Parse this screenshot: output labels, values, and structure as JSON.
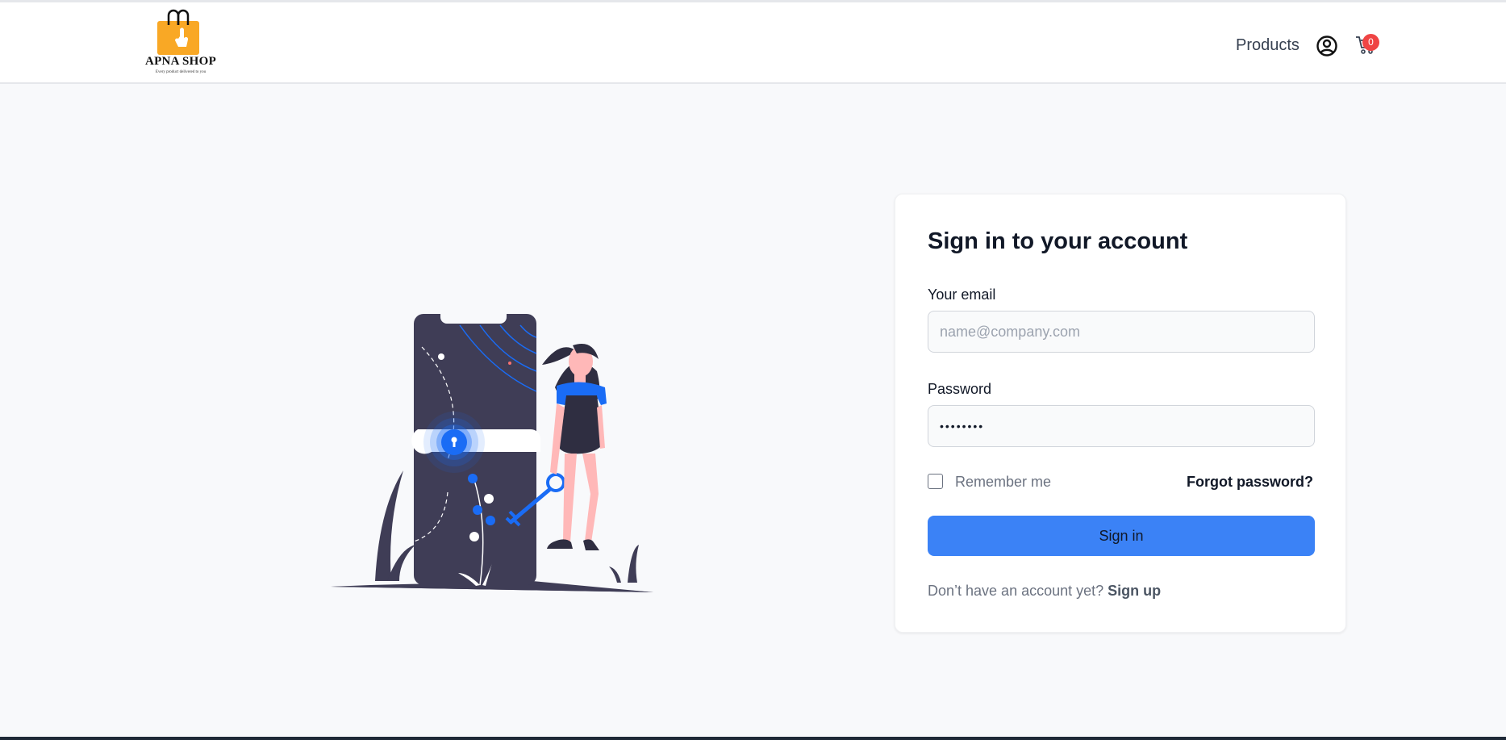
{
  "header": {
    "logo_name": "APNA SHOP",
    "logo_tagline": "Every product delivered to you",
    "nav_products": "Products",
    "cart_count": "0"
  },
  "login": {
    "title": "Sign in to your account",
    "email_label": "Your email",
    "email_placeholder": "name@company.com",
    "email_value": "",
    "password_label": "Password",
    "password_value": "••••••••",
    "remember_label": "Remember me",
    "remember_checked": false,
    "forgot_label": "Forgot password?",
    "signin_label": "Sign in",
    "signup_prompt": "Don’t have an account yet?",
    "signup_link": "Sign up"
  },
  "colors": {
    "accent": "#3b82f6",
    "badge": "#ef4444",
    "illustration_dark": "#3f3d56",
    "illustration_blue": "#1a6cf5"
  },
  "icons": [
    "shopping-bag-logo-icon",
    "user-circle-icon",
    "cart-icon",
    "lock-illustration"
  ]
}
